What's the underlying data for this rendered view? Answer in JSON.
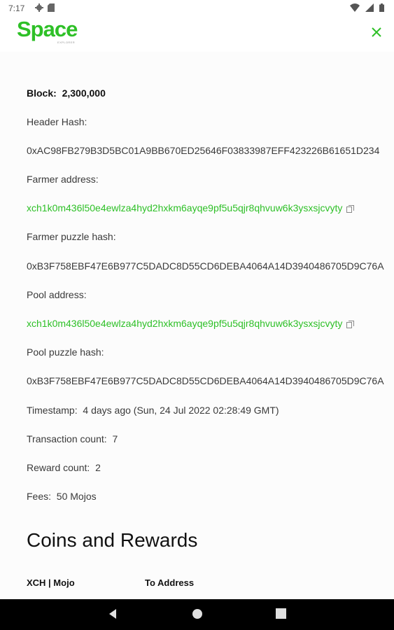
{
  "status_bar": {
    "time": "7:17",
    "icons": [
      "gear-icon",
      "sim-card-icon",
      "wifi-icon",
      "signal-icon",
      "battery-icon"
    ]
  },
  "header": {
    "logo_text": "Space",
    "logo_subtext": "EXPLORER",
    "close_icon": "close-icon",
    "accent_color": "#2ec027"
  },
  "block": {
    "label": "Block:",
    "number": "2,300,000",
    "header_hash_label": "Header Hash:",
    "header_hash": "0xAC98FB279B3D5BC01A9BB670ED25646F03833987EFF423226B61651D234",
    "farmer_address_label": "Farmer address:",
    "farmer_address": "xch1k0m436l50e4ewlza4hyd2hxkm6ayqe9pf5u5qjr8qhvuw6k3ysxsjcvyty",
    "farmer_puzzle_hash_label": "Farmer puzzle hash:",
    "farmer_puzzle_hash": "0xB3F758EBF47E6B977C5DADC8D55CD6DEBA4064A14D3940486705D9C76A",
    "pool_address_label": "Pool address:",
    "pool_address": "xch1k0m436l50e4ewlza4hyd2hxkm6ayqe9pf5u5qjr8qhvuw6k3ysxsjcvyty",
    "pool_puzzle_hash_label": "Pool puzzle hash:",
    "pool_puzzle_hash": "0xB3F758EBF47E6B977C5DADC8D55CD6DEBA4064A14D3940486705D9C76A",
    "timestamp_label": "Timestamp:",
    "timestamp": "4 days ago (Sun, 24 Jul 2022 02:28:49 GMT)",
    "transaction_count_label": "Transaction count:",
    "transaction_count": "7",
    "reward_count_label": "Reward count:",
    "reward_count": "2",
    "fees_label": "Fees:",
    "fees": "50 Mojos"
  },
  "coins_section": {
    "title": "Coins and Rewards",
    "columns": [
      "XCH | Mojo",
      "To Address"
    ]
  },
  "nav_bar": {
    "icons": [
      "back-icon",
      "home-icon",
      "recents-icon"
    ]
  }
}
